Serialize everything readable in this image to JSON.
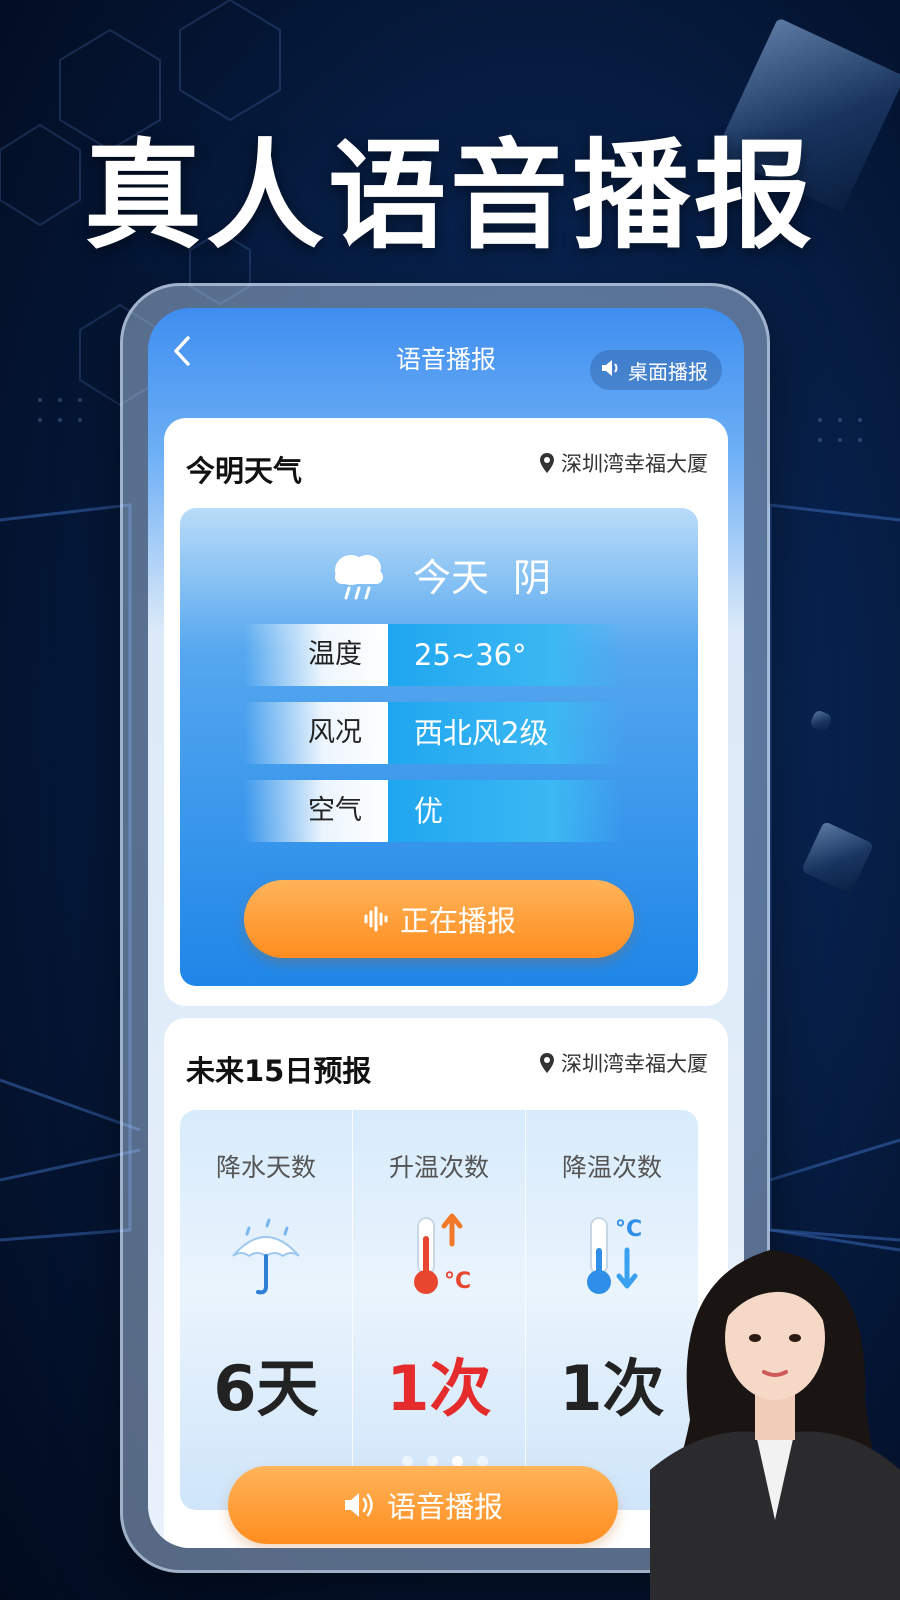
{
  "promo": {
    "headline": "真人语音播报"
  },
  "nav": {
    "title": "语音播报",
    "desktop_broadcast": "桌面播报"
  },
  "today_card": {
    "heading": "今明天气",
    "location": "深圳湾幸福大厦",
    "day": "今天",
    "condition": "阴",
    "rows": [
      {
        "label": "温度",
        "value": "25~36°"
      },
      {
        "label": "风况",
        "value": "西北风2级"
      },
      {
        "label": "空气",
        "value": "优"
      }
    ],
    "button": "正在播报"
  },
  "forecast_card": {
    "heading": "未来15日预报",
    "location": "深圳湾幸福大厦",
    "stats": [
      {
        "label": "降水天数",
        "value": "6天",
        "icon": "umbrella-icon"
      },
      {
        "label": "升温次数",
        "value": "1次",
        "icon": "thermometer-up-icon"
      },
      {
        "label": "降温次数",
        "value": "1次",
        "icon": "thermometer-down-icon"
      }
    ],
    "pager": {
      "count": 4,
      "active": 3
    },
    "button": "语音播报"
  },
  "colors": {
    "accent_orange": "#ff8d1f",
    "accent_blue": "#1f86e8",
    "rise_red": "#e52b2b"
  }
}
